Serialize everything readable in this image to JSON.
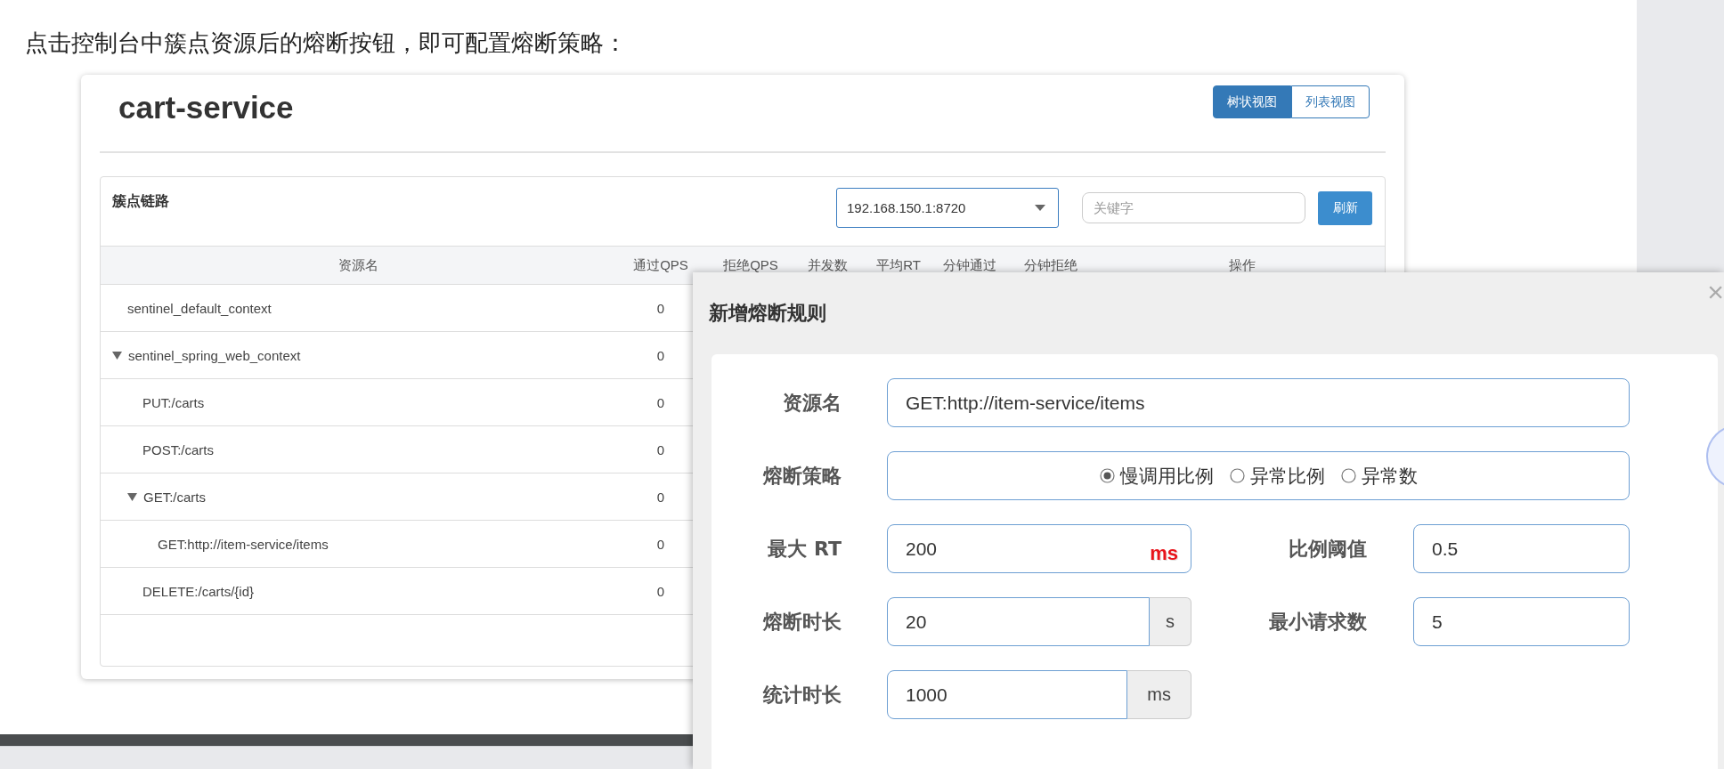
{
  "intro": "点击控制台中簇点资源后的熔断按钮，即可配置熔断策略：",
  "app": {
    "title": "cart-service",
    "view_tabs": [
      {
        "label": "树状视图",
        "selected": true
      },
      {
        "label": "列表视图",
        "selected": false
      }
    ],
    "panel": {
      "title": "簇点链路",
      "machine_select": {
        "value": "192.168.150.1:8720"
      },
      "search": {
        "placeholder": "关键字"
      },
      "refresh_button": "刷新",
      "table": {
        "columns": [
          "资源名",
          "通过QPS",
          "拒绝QPS",
          "并发数",
          "平均RT",
          "分钟通过",
          "分钟拒绝",
          "操作"
        ],
        "rows": [
          {
            "name": "sentinel_default_context",
            "pass_qps": "0"
          },
          {
            "name": "sentinel_spring_web_context",
            "pass_qps": "0",
            "expanded": true,
            "children": [
              {
                "name": "PUT:/carts",
                "pass_qps": "0"
              },
              {
                "name": "POST:/carts",
                "pass_qps": "0"
              },
              {
                "name": "GET:/carts",
                "pass_qps": "0",
                "expanded": true,
                "children": [
                  {
                    "name": "GET:http://item-service/items",
                    "pass_qps": "0"
                  }
                ]
              },
              {
                "name": "DELETE:/carts/{id}",
                "pass_qps": "0"
              }
            ]
          }
        ]
      }
    }
  },
  "dialog": {
    "title": "新增熔断规则",
    "close": "×",
    "form_rows": [
      {
        "fields": [
          {
            "kind": "text",
            "label": "资源名",
            "value": "GET:http://item-service/items"
          }
        ]
      },
      {
        "fields": [
          {
            "kind": "radio",
            "label": "熔断策略",
            "options": [
              {
                "label": "慢调用比例",
                "selected": true
              },
              {
                "label": "异常比例",
                "selected": false
              },
              {
                "label": "异常数",
                "selected": false
              }
            ]
          }
        ]
      },
      {
        "fields": [
          {
            "kind": "inline_unit",
            "label": "最大 RT",
            "value": "200",
            "unit": "ms"
          },
          {
            "kind": "text",
            "label": "比例阈值",
            "value": "0.5"
          }
        ]
      },
      {
        "fields": [
          {
            "kind": "addon",
            "label": "熔断时长",
            "value": "20",
            "unit": "s"
          },
          {
            "kind": "text",
            "label": "最小请求数",
            "value": "5"
          }
        ]
      },
      {
        "fields": [
          {
            "kind": "addon",
            "label": "统计时长",
            "value": "1000",
            "unit": "ms"
          }
        ]
      }
    ]
  }
}
